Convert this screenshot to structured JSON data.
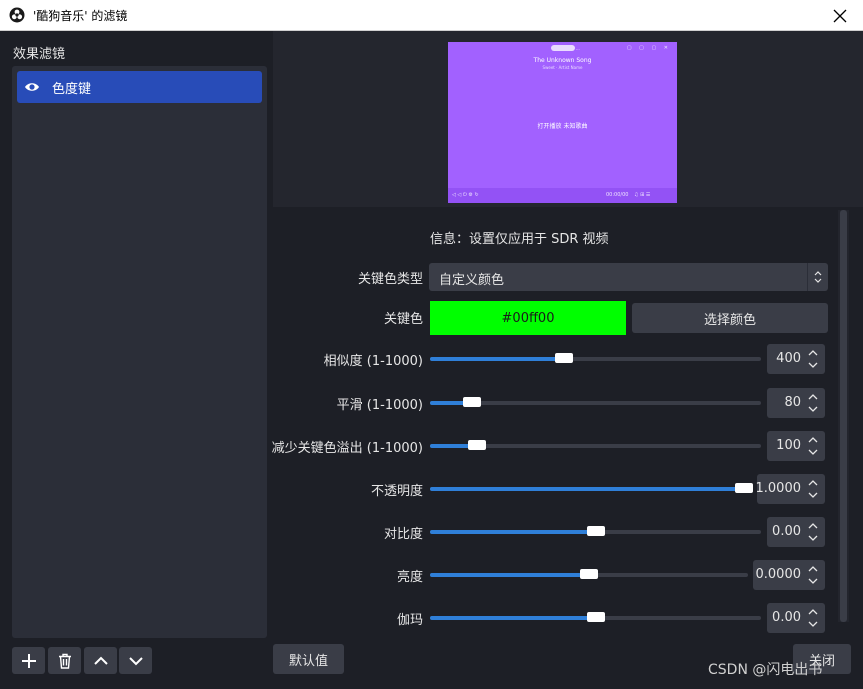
{
  "window": {
    "title": "'酷狗音乐' 的滤镜",
    "close_glyph": "✕"
  },
  "left": {
    "label": "效果滤镜",
    "filters": [
      {
        "name": "色度键",
        "visible": true
      }
    ]
  },
  "preview": {
    "pill_text": "···",
    "header_text": "The Unknown Song",
    "sub_text": "Sweet · Artist Name",
    "center_text": "打开播放    未知歌曲",
    "bar_left": "◁  ◁  ⏻  ⚙  ↻",
    "bar_time": "00:00/00",
    "bar_right": "♫  ⊞  ☰"
  },
  "settings": {
    "info": "信息：设置仅应用于 SDR 视频",
    "key_type": {
      "label": "关键色类型",
      "value": "自定义颜色"
    },
    "key_color": {
      "label": "关键色",
      "value": "#00ff00",
      "choose_label": "选择颜色"
    },
    "sliders": [
      {
        "label": "相似度 (1-1000)",
        "value": "400",
        "fraction": 0.4
      },
      {
        "label": "平滑 (1-1000)",
        "value": "80",
        "fraction": 0.105
      },
      {
        "label": "减少关键色溢出 (1-1000)",
        "value": "100",
        "fraction": 0.123
      },
      {
        "label": "不透明度",
        "value": "1.0000",
        "fraction": 1.0
      },
      {
        "label": "对比度",
        "value": "0.00",
        "fraction": 0.5
      },
      {
        "label": "亮度",
        "value": "0.0000",
        "fraction": 0.5
      },
      {
        "label": "伽玛",
        "value": "0.00",
        "fraction": 0.5
      }
    ]
  },
  "buttons": {
    "defaults": "默认值",
    "close": "关闭"
  },
  "watermark": "CSDN @闪电出书",
  "colors": {
    "accent": "#284cb8",
    "slider_fill": "#2f7fd8",
    "key_color": "#00ff00",
    "preview_bg": "#a261ff"
  }
}
